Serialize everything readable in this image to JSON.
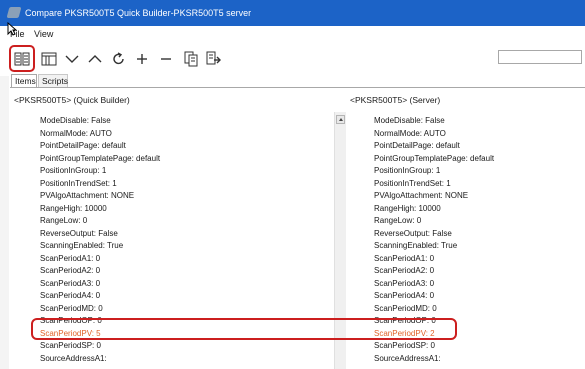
{
  "window": {
    "title": "Compare PKSR500T5 Quick Builder-PKSR500T5 server"
  },
  "menu": [
    {
      "label": "File"
    },
    {
      "label": "View"
    }
  ],
  "toolbar": {
    "buttons": [
      {
        "icon": "compare-view-icon",
        "selected": true
      },
      {
        "icon": "split-view-icon"
      },
      {
        "icon": "chevron-down-icon"
      },
      {
        "icon": "chevron-up-icon"
      },
      {
        "icon": "refresh-icon"
      },
      {
        "icon": "plus-icon"
      },
      {
        "icon": "minus-icon"
      },
      {
        "icon": "copy-icon"
      },
      {
        "icon": "export-icon"
      }
    ],
    "search": {
      "value": "",
      "placeholder": ""
    }
  },
  "tabs": [
    {
      "label": "Items",
      "active": true
    },
    {
      "label": "Scripts",
      "active": false
    }
  ],
  "left_pane": {
    "header": "<PKSR500T5> (Quick Builder)",
    "rows": [
      "ModeDisable: False",
      "NormalMode: AUTO",
      "PointDetailPage: default",
      "PointGroupTemplatePage: default",
      "PositionInGroup: 1",
      "PositionInTrendSet: 1",
      "PVAlgoAttachment: NONE",
      "RangeHigh: 10000",
      "RangeLow: 0",
      "ReverseOutput: False",
      "ScanningEnabled: True",
      "ScanPeriodA1: 0",
      "ScanPeriodA2: 0",
      "ScanPeriodA3: 0",
      "ScanPeriodA4: 0",
      "ScanPeriodMD: 0",
      "ScanPeriodOP: 0",
      "ScanPeriodPV: 5",
      "ScanPeriodSP: 0",
      "SourceAddressA1:"
    ],
    "changed_index": 17
  },
  "right_pane": {
    "header": "<PKSR500T5> (Server)",
    "rows": [
      "ModeDisable: False",
      "NormalMode: AUTO",
      "PointDetailPage: default",
      "PointGroupTemplatePage: default",
      "PositionInGroup: 1",
      "PositionInTrendSet: 1",
      "PVAlgoAttachment: NONE",
      "RangeHigh: 10000",
      "RangeLow: 0",
      "ReverseOutput: False",
      "ScanningEnabled: True",
      "ScanPeriodA1: 0",
      "ScanPeriodA2: 0",
      "ScanPeriodA3: 0",
      "ScanPeriodA4: 0",
      "ScanPeriodMD: 0",
      "ScanPeriodOP: 0",
      "ScanPeriodPV: 2",
      "ScanPeriodSP: 0",
      "SourceAddressA1:"
    ],
    "changed_index": 17
  },
  "colors": {
    "titlebar": "#1c63c7",
    "changed_text": "#e0632a",
    "highlight_box": "#cc1f1f"
  }
}
